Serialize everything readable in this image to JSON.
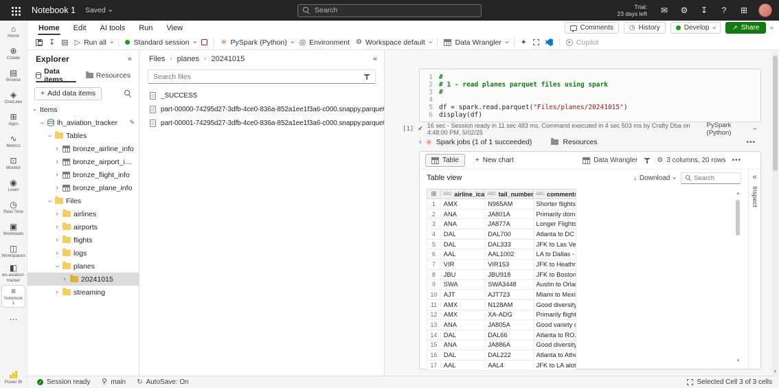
{
  "colors": {
    "topbar_bg": "#242424",
    "share_green": "#107c10",
    "session_green": "#13a10e",
    "stop_red": "#c50f1f",
    "folder_yellow": "#f6ce5f",
    "selected_row_gray": "#dbdbdb",
    "comment_green": "#0e7d0e",
    "string_red": "#a31515",
    "spark_orange": "#e25a1c",
    "powerbi_yellow": "#f2c811"
  },
  "topbar": {
    "title": "Notebook 1",
    "saved": "Saved",
    "search_placeholder": "Search",
    "trial_line1": "Trial:",
    "trial_line2": "23 days left"
  },
  "menubar": {
    "tabs": [
      {
        "label": "Home",
        "active": true
      },
      {
        "label": "Edit",
        "active": false
      },
      {
        "label": "AI tools",
        "active": false
      },
      {
        "label": "Run",
        "active": false
      },
      {
        "label": "View",
        "active": false
      }
    ],
    "comments": "Comments",
    "history": "History",
    "develop": "Develop",
    "share": "Share"
  },
  "toolbar": {
    "run_all": "Run all",
    "session_label": "Standard session",
    "language_label": "PySpark (Python)",
    "environment_label": "Environment",
    "workspace_label": "Workspace default",
    "data_wrangler_label": "Data Wrangler",
    "copilot_label": "Copilot"
  },
  "rail": {
    "items": [
      {
        "name": "home",
        "label": "Home",
        "glyph": "⌂",
        "selected": false
      },
      {
        "name": "create",
        "label": "Create",
        "glyph": "⊕",
        "selected": false
      },
      {
        "name": "browse",
        "label": "Browse",
        "glyph": "▤",
        "selected": false
      },
      {
        "name": "onelake",
        "label": "OneLake",
        "glyph": "◈",
        "selected": false
      },
      {
        "name": "apps",
        "label": "Apps",
        "glyph": "⊞",
        "selected": false
      },
      {
        "name": "metrics",
        "label": "Metrics",
        "glyph": "∿",
        "selected": false
      },
      {
        "name": "monitor",
        "label": "Monitor",
        "glyph": "⊡",
        "selected": false
      },
      {
        "name": "learn",
        "label": "Learn",
        "glyph": "◉",
        "selected": false
      },
      {
        "name": "real-time",
        "label": "Real-Time",
        "glyph": "◷",
        "selected": false
      },
      {
        "name": "workloads",
        "label": "Workloads",
        "glyph": "▣",
        "selected": false
      },
      {
        "name": "workspaces",
        "label": "Workspaces",
        "glyph": "◫",
        "selected": false
      },
      {
        "name": "ws-aviation-tracker",
        "label": "ws-aviation-tracker",
        "glyph": "◧",
        "selected": false
      },
      {
        "name": "notebook-1",
        "label": "Notebook 1",
        "glyph": "≡",
        "selected": true
      },
      {
        "name": "more",
        "label": "",
        "glyph": "⋯",
        "selected": false
      }
    ],
    "bottom_label": "Power BI"
  },
  "explorer": {
    "title": "Explorer",
    "tab_data_items": "Data items",
    "tab_resources": "Resources",
    "add_button": "Add data items",
    "tree": [
      {
        "label": "Items",
        "level": 0,
        "icon": "none",
        "chev": "down",
        "selected": false,
        "trailing": ""
      },
      {
        "label": "lh_aviation_tracker",
        "level": 1,
        "icon": "lakehouse",
        "chev": "down",
        "selected": false,
        "trailing": "edit"
      },
      {
        "label": "Tables",
        "level": 2,
        "icon": "folder",
        "chev": "down",
        "selected": false,
        "trailing": ""
      },
      {
        "label": "bronze_airline_info",
        "level": 3,
        "icon": "table",
        "chev": "right",
        "selected": false,
        "trailing": ""
      },
      {
        "label": "bronze_airport_info",
        "level": 3,
        "icon": "table",
        "chev": "right",
        "selected": false,
        "trailing": ""
      },
      {
        "label": "bronze_flight_info",
        "level": 3,
        "icon": "table",
        "chev": "right",
        "selected": false,
        "trailing": ""
      },
      {
        "label": "bronze_plane_info",
        "level": 3,
        "icon": "table",
        "chev": "right",
        "selected": false,
        "trailing": ""
      },
      {
        "label": "Files",
        "level": 2,
        "icon": "folder",
        "chev": "down",
        "selected": false,
        "trailing": ""
      },
      {
        "label": "airlines",
        "level": 3,
        "icon": "folder",
        "chev": "right",
        "selected": false,
        "trailing": ""
      },
      {
        "label": "airports",
        "level": 3,
        "icon": "folder",
        "chev": "right",
        "selected": false,
        "trailing": ""
      },
      {
        "label": "flights",
        "level": 3,
        "icon": "folder",
        "chev": "right",
        "selected": false,
        "trailing": ""
      },
      {
        "label": "logs",
        "level": 3,
        "icon": "folder",
        "chev": "right",
        "selected": false,
        "trailing": ""
      },
      {
        "label": "planes",
        "level": 3,
        "icon": "folder",
        "chev": "down",
        "selected": false,
        "trailing": ""
      },
      {
        "label": "20241015",
        "level": 4,
        "icon": "folder-dark",
        "chev": "right",
        "selected": true,
        "trailing": ""
      },
      {
        "label": "streaming",
        "level": 3,
        "icon": "folder",
        "chev": "right",
        "selected": false,
        "trailing": ""
      }
    ]
  },
  "files_panel": {
    "breadcrumb": [
      "Files",
      "planes",
      "20241015"
    ],
    "search_placeholder": "Search files",
    "files": [
      "_SUCCESS",
      "part-00000-74295d27-3dfb-4ce0-836a-852a1ee1f3a6-c000.snappy.parquet",
      "part-00001-74295d27-3dfb-4ce0-836a-852a1ee1f3a6-c000.snappy.parquet"
    ]
  },
  "notebook": {
    "cell": {
      "lines": [
        {
          "n": "1",
          "segs": [
            {
              "t": "#",
              "c": "comment"
            }
          ]
        },
        {
          "n": "2",
          "segs": [
            {
              "t": "#  1 - read planes parquet files using spark",
              "c": "comment"
            }
          ]
        },
        {
          "n": "3",
          "segs": [
            {
              "t": "#",
              "c": "comment"
            }
          ]
        },
        {
          "n": "4",
          "segs": []
        },
        {
          "n": "5",
          "segs": [
            {
              "t": "df = spark.read.parquet(",
              "c": "code"
            },
            {
              "t": "\"Files/planes/20241015\"",
              "c": "string"
            },
            {
              "t": ")",
              "c": "code"
            }
          ]
        },
        {
          "n": "6",
          "segs": [
            {
              "t": "display(df)",
              "c": "code"
            }
          ]
        }
      ],
      "exec_index": "[1]",
      "exec_status": "16 sec - Session ready in 11 sec 483 ms. Command executed in 4 sec 503 ms by Crafty Dba on 4:48:00 PM, 5/02/25",
      "kernel": "PySpark (Python)"
    },
    "jobs_tab": "Spark jobs (1 of 1 succeeded)",
    "resources_tab": "Resources",
    "output": {
      "table_button": "Table",
      "new_chart_button": "New chart",
      "data_wrangler": "Data Wrangler",
      "dims": "3 columns, 20 rows",
      "view_title": "Table view",
      "download": "Download",
      "search_placeholder": "Search",
      "inspect_label": "Inspect",
      "col_type": "ABC",
      "columns": [
        "airline_icao",
        "tail_number",
        "comments"
      ],
      "rows": [
        [
          "AMX",
          "N965AM",
          "Shorter flights ..."
        ],
        [
          "ANA",
          "JA801A",
          "Primarily dome..."
        ],
        [
          "ANA",
          "JA877A",
          "Longer Flights ..."
        ],
        [
          "DAL",
          "DAL700",
          "Atlanta to DC -..."
        ],
        [
          "DAL",
          "DAL333",
          "JFK to Las Veg..."
        ],
        [
          "AAL",
          "AAL1002",
          "LA to Dallas - ..."
        ],
        [
          "VIR",
          "VIR153",
          "JFK to Heathro..."
        ],
        [
          "JBU",
          "JBU918",
          "JFK to Boston L..."
        ],
        [
          "SWA",
          "SWA3448",
          "Austin to Orlan..."
        ],
        [
          "AJT",
          "AJT723",
          "Miami to Mexi..."
        ],
        [
          "AMX",
          "N128AM",
          "Good diversity ..."
        ],
        [
          "AMX",
          "XA-ADG",
          "Primarily flight..."
        ],
        [
          "ANA",
          "JA805A",
          "Good variety o..."
        ],
        [
          "DAL",
          "DAL66",
          "Atlanta to RO..."
        ],
        [
          "ANA",
          "JA886A",
          "Good diversity ..."
        ],
        [
          "DAL",
          "DAL222",
          "Atlanta to Athe..."
        ],
        [
          "AAL",
          "AAL4",
          "JFK to LA alot ..."
        ]
      ]
    }
  },
  "statusbar": {
    "session": "Session ready",
    "branch": "main",
    "autosave": "AutoSave: On",
    "selection": "Selected Cell 3 of 3 cells"
  }
}
